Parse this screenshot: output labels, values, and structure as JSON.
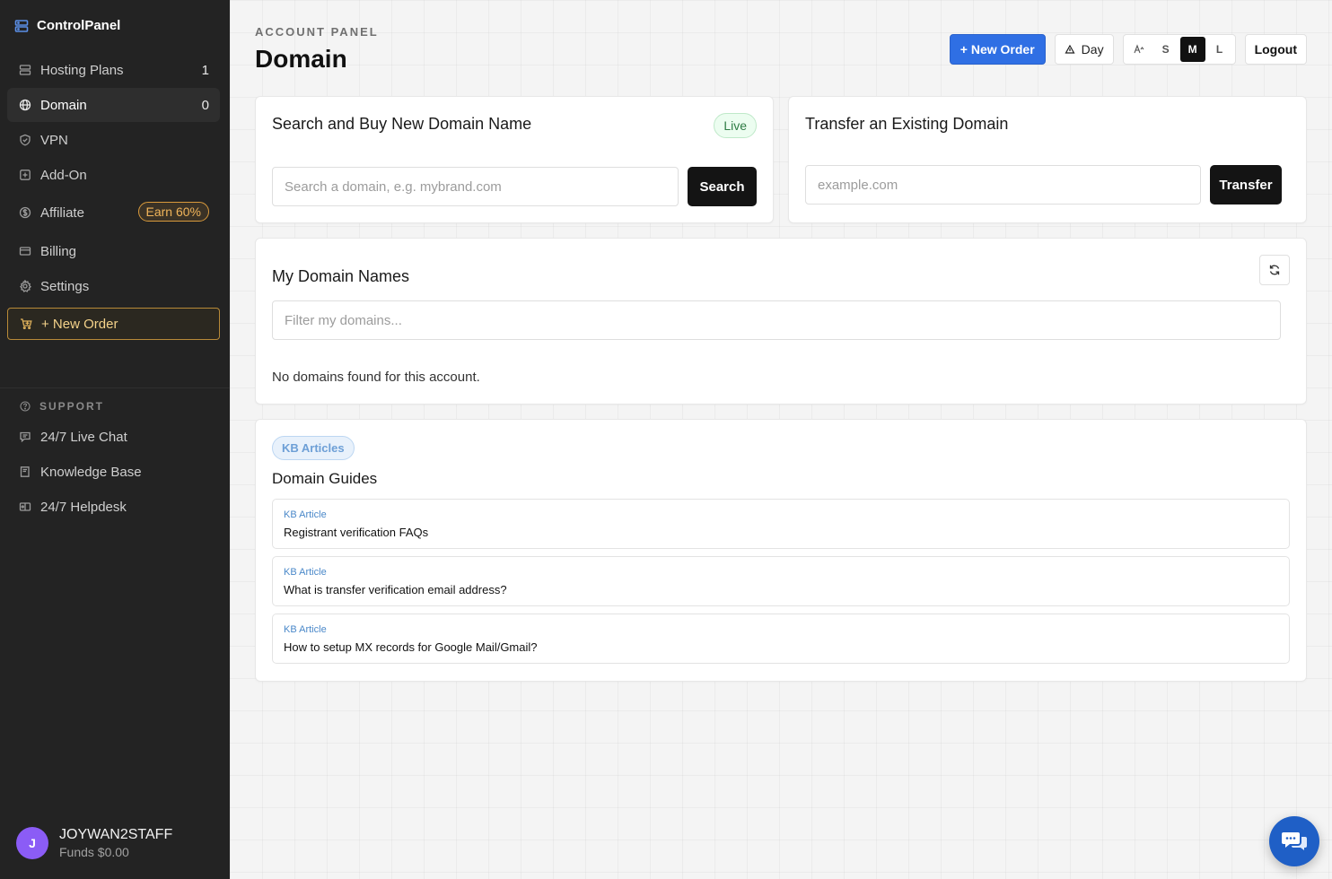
{
  "brand": {
    "name": "ControlPanel"
  },
  "sidebar": {
    "items": [
      {
        "label": "Hosting Plans",
        "count": "1",
        "icon": "server-icon"
      },
      {
        "label": "Domain",
        "count": "0",
        "icon": "globe-icon",
        "active": true
      },
      {
        "label": "VPN",
        "icon": "shield-icon"
      },
      {
        "label": "Add-On",
        "icon": "plus-square-icon"
      },
      {
        "label": "Affiliate",
        "badge": "Earn 60%",
        "icon": "dollar-icon"
      },
      {
        "label": "Billing",
        "icon": "credit-card-icon"
      },
      {
        "label": "Settings",
        "icon": "gear-icon"
      }
    ],
    "new_order_label": "+ New Order",
    "support_heading": "SUPPORT",
    "support_items": [
      {
        "label": "24/7 Live Chat",
        "icon": "chat-icon"
      },
      {
        "label": "Knowledge Base",
        "icon": "book-icon"
      },
      {
        "label": "24/7 Helpdesk",
        "icon": "ticket-icon"
      }
    ],
    "user": {
      "initial": "J",
      "name": "JOYWAN2STAFF",
      "funds": "Funds $0.00"
    }
  },
  "header": {
    "eyebrow": "ACCOUNT PANEL",
    "title": "Domain",
    "new_order_label": "+ New Order",
    "theme_label": "Day",
    "text_sizes": [
      "S",
      "M",
      "L"
    ],
    "active_text_size": "M",
    "logout_label": "Logout"
  },
  "search_card": {
    "title": "Search and Buy New Domain Name",
    "status_badge": "Live",
    "placeholder": "Search a domain, e.g. mybrand.com",
    "button_label": "Search"
  },
  "transfer_card": {
    "title": "Transfer an Existing Domain",
    "placeholder": "example.com",
    "button_label": "Transfer"
  },
  "my_domains": {
    "title": "My Domain Names",
    "filter_placeholder": "Filter my domains...",
    "empty_text": "No domains found for this account."
  },
  "kb": {
    "chip": "KB Articles",
    "title": "Domain Guides",
    "articles": [
      {
        "label": "KB Article",
        "title": "Registrant verification FAQs"
      },
      {
        "label": "KB Article",
        "title": "What is transfer verification email address?"
      },
      {
        "label": "KB Article",
        "title": "How to setup MX records for Google Mail/Gmail?"
      }
    ]
  },
  "colors": {
    "primary": "#2f6fe4",
    "sidebar_bg": "#232323",
    "accent_gold": "#d99a3c",
    "avatar": "#8b5cf6",
    "live_green": "#2f7c45"
  }
}
